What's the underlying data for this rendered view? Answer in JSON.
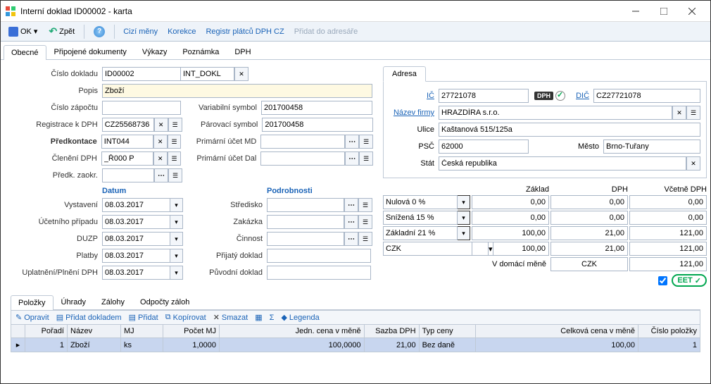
{
  "window": {
    "title": "Interní doklad ID00002 - karta"
  },
  "toolbar": {
    "ok_label": "OK",
    "back_label": "Zpět",
    "links": [
      "Cizí měny",
      "Korekce",
      "Registr plátců DPH CZ",
      "Přidat do adresáře"
    ]
  },
  "main_tabs": [
    "Obecné",
    "Připojené dokumenty",
    "Výkazy",
    "Poznámka",
    "DPH"
  ],
  "labels": {
    "cislo_dokladu": "Číslo dokladu",
    "typ_dokladu": "INT_DOKL",
    "popis": "Popis",
    "cislo_zapoctu": "Číslo zápočtu",
    "var_symbol": "Variabilní symbol",
    "parovaci_symbol": "Párovací symbol",
    "registrace": "Registrace k DPH",
    "predkontace": "Předkontace",
    "primarni_md": "Primární účet MD",
    "cleneni": "Členění DPH",
    "primarni_dal": "Primární účet Dal",
    "predk_zaokr": "Předk. zaokr.",
    "datum": "Datum",
    "vystaveni": "Vystavení",
    "ucet_pripadu": "Účetního případu",
    "duzp": "DUZP",
    "platby": "Platby",
    "uplatneni": "Uplatnění/Plnění DPH",
    "podrobnosti": "Podrobnosti",
    "stredisko": "Středisko",
    "zakazka": "Zakázka",
    "cinnost": "Činnost",
    "prijaty": "Přijatý doklad",
    "puvodni": "Původní doklad",
    "v_domaci": "V domácí měně"
  },
  "values": {
    "cislo_dokladu": "ID00002",
    "popis": "Zboží",
    "var_symbol": "201700458",
    "parovaci_symbol": "201700458",
    "registrace": "CZ25568736",
    "predkontace": "INT044",
    "cleneni": "_Ř000 P",
    "date": "08.03.2017",
    "currency": "CZK"
  },
  "address": {
    "tab": "Adresa",
    "ic_label": "IČ",
    "ic": "27721078",
    "dph_badge": "DPH",
    "dic_label": "DIČ",
    "dic": "CZ27721078",
    "nazev_label": "Název firmy",
    "nazev": "HRAZDÍRA s.r.o.",
    "ulice_label": "Ulice",
    "ulice": "Kaštanová 515/125a",
    "psc_label": "PSČ",
    "psc": "62000",
    "mesto_label": "Město",
    "mesto": "Brno-Tuřany",
    "stat_label": "Stát",
    "stat": "Česká republika"
  },
  "vat": {
    "head_zaklad": "Základ",
    "head_dph": "DPH",
    "head_vcetne": "Včetně DPH",
    "rows": [
      {
        "label": "Nulová 0 %",
        "zaklad": "0,00",
        "dph": "0,00",
        "vcetne": "0,00"
      },
      {
        "label": "Snížená 15 %",
        "zaklad": "0,00",
        "dph": "0,00",
        "vcetne": "0,00"
      },
      {
        "label": "Základní 21 %",
        "zaklad": "100,00",
        "dph": "21,00",
        "vcetne": "121,00"
      }
    ],
    "total": {
      "zaklad": "100,00",
      "dph": "21,00",
      "vcetne": "121,00"
    },
    "dom_currency": "CZK",
    "dom_total": "121,00"
  },
  "eet_label": "EET",
  "bottom_tabs": [
    "Položky",
    "Úhrady",
    "Zálohy",
    "Odpočty záloh"
  ],
  "grid_toolbar": {
    "opravit": "Opravit",
    "pridat_dokladem": "Přidat dokladem",
    "pridat": "Přidat",
    "kopirovat": "Kopírovat",
    "smazat": "Smazat",
    "legenda": "Legenda"
  },
  "grid": {
    "cols": [
      "Pořadí",
      "Název",
      "MJ",
      "Počet MJ",
      "Jedn. cena v měně",
      "Sazba DPH",
      "Typ ceny",
      "Celková cena v měně",
      "Číslo položky"
    ],
    "row": {
      "poradi": "1",
      "nazev": "Zboží",
      "mj": "ks",
      "pocet": "1,0000",
      "jedn": "100,0000",
      "sazba": "21,00",
      "typ": "Bez daně",
      "celkova": "100,00",
      "cislo": "1"
    }
  }
}
